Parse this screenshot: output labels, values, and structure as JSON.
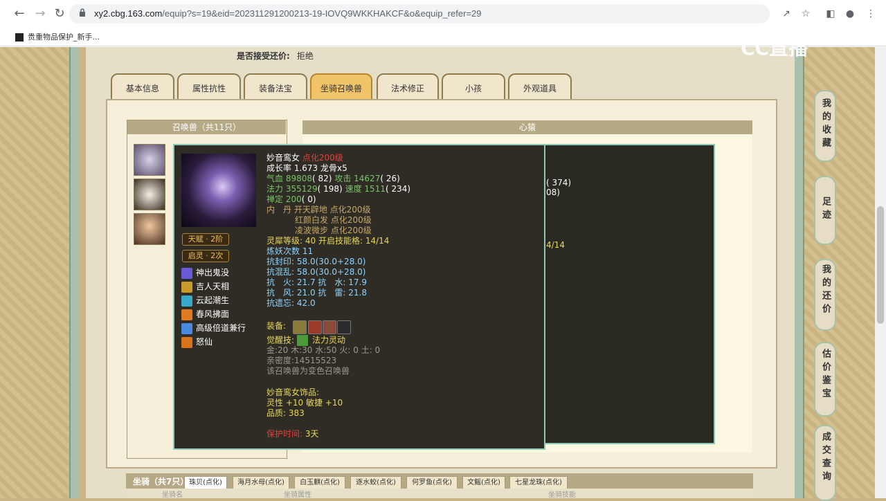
{
  "browser": {
    "url_host": "xy2.cbg.163.com",
    "url_path": "/equip?s=19&eid=202311291200213-19-IOVQ9WKKHAKCF&o&equip_refer=29",
    "bookmark": "贵重物品保护_新手..."
  },
  "watermark": "CC直播",
  "accept_offer": {
    "label": "是否接受还价:",
    "value": "拒绝"
  },
  "tabs": [
    "基本信息",
    "属性抗性",
    "装备法宝",
    "坐骑召唤兽",
    "法术修正",
    "小孩",
    "外观道具"
  ],
  "active_tab": "坐骑召唤兽",
  "summon_panel": {
    "title": "召唤兽（共11只）"
  },
  "xinyuan_panel": {
    "title": "心猿"
  },
  "side_nav": [
    "我的收藏",
    "足迹",
    "我的还价",
    "估价鉴宝",
    "成交查询"
  ],
  "bg_fragments": [
    "( 374)",
    "08)",
    "4/14"
  ],
  "popup": {
    "name": "妙音鸾女",
    "rank": "点化200级",
    "growth": "成长率 1.673 龙骨x5",
    "hp_label": "气血",
    "hp": "89808",
    "hp_add": "( 82)",
    "atk_label": "攻击",
    "atk": "14627",
    "atk_add": "( 26)",
    "mp_label": "法力",
    "mp": "355129",
    "mp_add": "( 198)",
    "spd_label": "速度",
    "spd": "1511",
    "spd_add": "( 234)",
    "zen_label": "禅定",
    "zen": "200",
    "zen_add": "( 0)",
    "neidan_label": "内　丹",
    "neidan": [
      "开天辟地 点化200级",
      "红颜白发 点化200级",
      "凌波微步 点化200级"
    ],
    "lingxi": "灵犀等级:",
    "lingxi_val": "40 开启技能格:",
    "lingxi_slots": "14/14",
    "refine": "炼妖次数 11",
    "kang_seal_label": "抗封印:",
    "kang_seal_a": "58.0(30.0",
    "kang_seal_b": "+28.0)",
    "kang_chaos_label": "抗混乱:",
    "kang_chaos_a": "58.0(30.0",
    "kang_chaos_b": "+28.0)",
    "kang_fire": "抗　火: 21.7 抗　水: 17.9",
    "kang_wind": "抗　风: 21.0 抗　雷: 21.8",
    "kang_forget": "抗遗忘: 42.0",
    "equip_label": "装备:",
    "awaken_label": "觉醒技:",
    "awaken": "法力灵动",
    "elements": "金:20 木:30 水:50 火: 0 土: 0",
    "intimacy": "亲密度:14515523",
    "variant": "该召唤兽为变色召唤兽",
    "acc_title": "妙音鸾女饰品:",
    "acc_attr": "灵性 +10 敏捷 +10",
    "acc_quality": "品质: 383",
    "protect_label": "保护时间:",
    "protect_val": "3天",
    "talent": "天赋 · 2阶",
    "qiling": "启灵 · 2次",
    "skills": [
      {
        "name": "神出鬼没",
        "color": "#6a5ad8"
      },
      {
        "name": "吉人天相",
        "color": "#c89a2a"
      },
      {
        "name": "云起潮生",
        "color": "#3aa8c8"
      },
      {
        "name": "春风拂面",
        "color": "#e07a20"
      },
      {
        "name": "高级倍道兼行",
        "color": "#4a8ae0"
      },
      {
        "name": "怒仙",
        "color": "#d8741a"
      }
    ]
  },
  "mounts": {
    "title": "坐骑（共7只）",
    "tabs": [
      "珠贝(点化)",
      "海月水母(点化)",
      "白玉麒(点化)",
      "逐水蛟(点化)",
      "何罗鱼(点化)",
      "文鳐(点化)",
      "七星龙珠(点化)"
    ],
    "columns": [
      "坐骑名",
      "坐骑属性",
      "坐骑技能"
    ]
  }
}
